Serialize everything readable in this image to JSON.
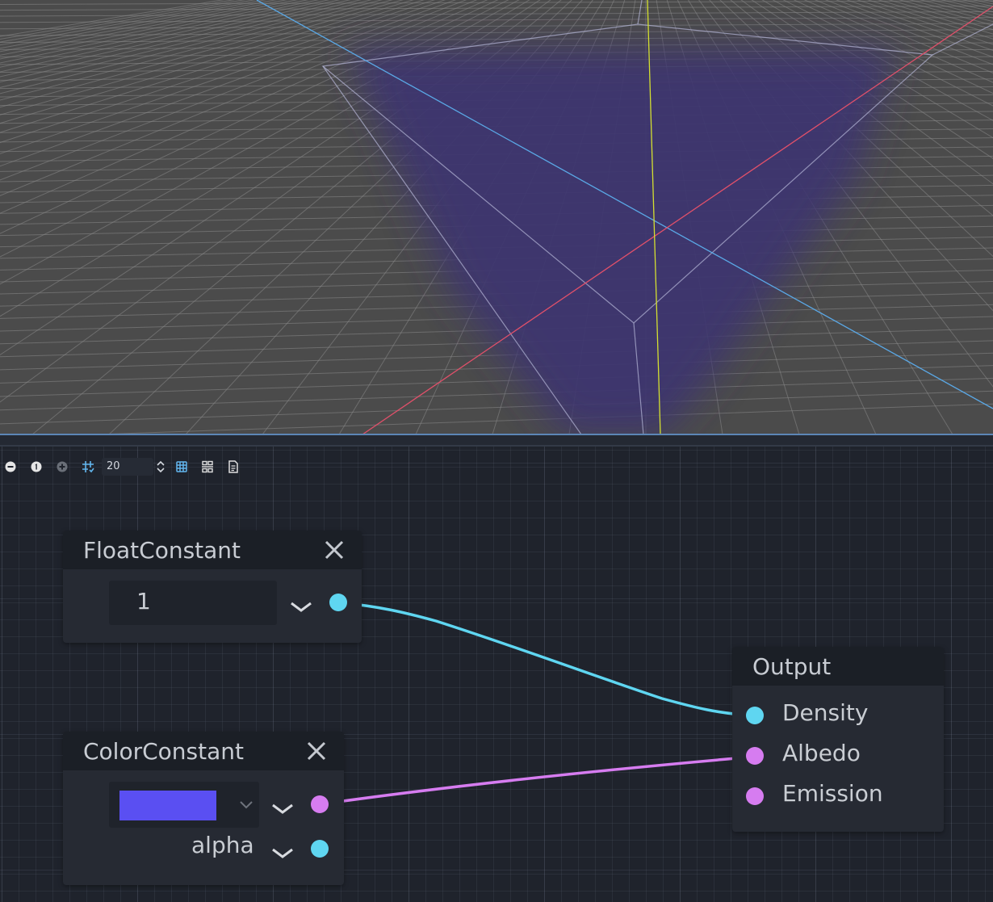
{
  "toolbar": {
    "zoom_out_icon": "minus-circle-icon",
    "zoom_reset_icon": "one-circle-icon",
    "zoom_in_icon": "plus-circle-icon",
    "snap_icon": "snap-grid-icon",
    "snap_value": "20",
    "grid_icon": "grid-toggle-icon",
    "minimap_icon": "arrange-nodes-icon",
    "script_icon": "document-icon"
  },
  "nodes": {
    "float_constant": {
      "title": "FloatConstant",
      "value": "1",
      "port_color": "#5fd6f1"
    },
    "color_constant": {
      "title": "ColorConstant",
      "swatch_color": "#5a4ff2",
      "alpha_label": "alpha",
      "rgb_port_color": "#d67cf0",
      "alpha_port_color": "#5fd6f1"
    },
    "output": {
      "title": "Output",
      "ports": [
        {
          "label": "Density",
          "color": "#5fd6f1"
        },
        {
          "label": "Albedo",
          "color": "#d67cf0"
        },
        {
          "label": "Emission",
          "color": "#d67cf0"
        }
      ]
    }
  },
  "colors": {
    "float_wire": "#5fd6f1",
    "color_wire": "#d67cf0",
    "fog_volume": "#3e3670",
    "x_axis": "#e0506a",
    "y_axis": "#d4e030",
    "z_axis": "#5aa8e6"
  }
}
